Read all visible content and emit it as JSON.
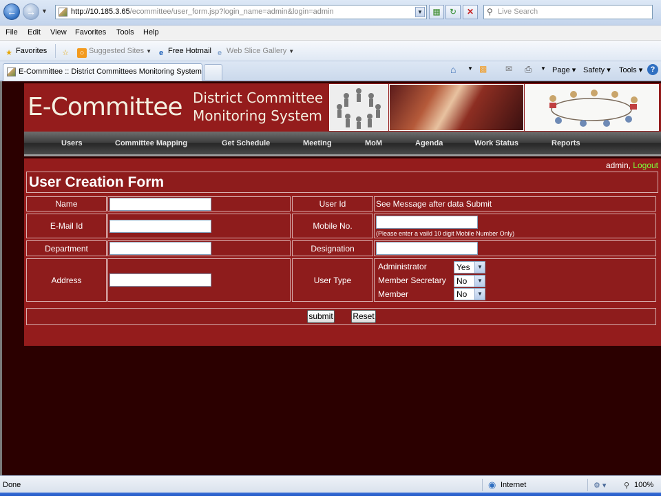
{
  "browser": {
    "url_host": "http://10.185.3.65",
    "url_path": "/ecommittee/user_form.jsp?login_name=admin&login=admin",
    "search_placeholder": "Live Search",
    "menu": [
      "File",
      "Edit",
      "View",
      "Favorites",
      "Tools",
      "Help"
    ],
    "favorites_label": "Favorites",
    "fav_items": [
      "Suggested Sites",
      "Free Hotmail",
      "Web Slice Gallery"
    ],
    "tab_title": "E-Committee :: District Committees Monitoring System",
    "commands": {
      "page": "Page",
      "safety": "Safety",
      "tools": "Tools"
    },
    "status": {
      "left": "Done",
      "zone": "Internet",
      "zoom": "100%"
    }
  },
  "site": {
    "logo": "E-Committee",
    "subtitle_line1": "District Committee",
    "subtitle_line2": "Monitoring System",
    "nav": [
      "Users",
      "Committee Mapping",
      "Get Schedule",
      "Meeting",
      "MoM",
      "Agenda",
      "Work Status",
      "Reports"
    ],
    "user": "admin",
    "user_sep": ", ",
    "logout": "Logout"
  },
  "form": {
    "title": "User Creation Form",
    "name_label": "Name",
    "userid_label": "User Id",
    "userid_value": "See Message after data Submit",
    "email_label": "E-Mail Id",
    "mobile_label": "Mobile No.",
    "mobile_hint": "(Please enter a vaild 10 digit Mobile Number Only)",
    "department_label": "Department",
    "designation_label": "Designation",
    "address_label": "Address",
    "usertype_label": "User Type",
    "usertype_options": [
      {
        "label": "Administrator",
        "value": "Yes"
      },
      {
        "label": "Member Secretary",
        "value": "No"
      },
      {
        "label": "Member",
        "value": "No"
      }
    ],
    "submit_label": "submit",
    "reset_label": "Reset"
  },
  "colors": {
    "page_bg": "#2b0000",
    "form_bg": "#941c1c",
    "logout": "#7cff3a"
  }
}
